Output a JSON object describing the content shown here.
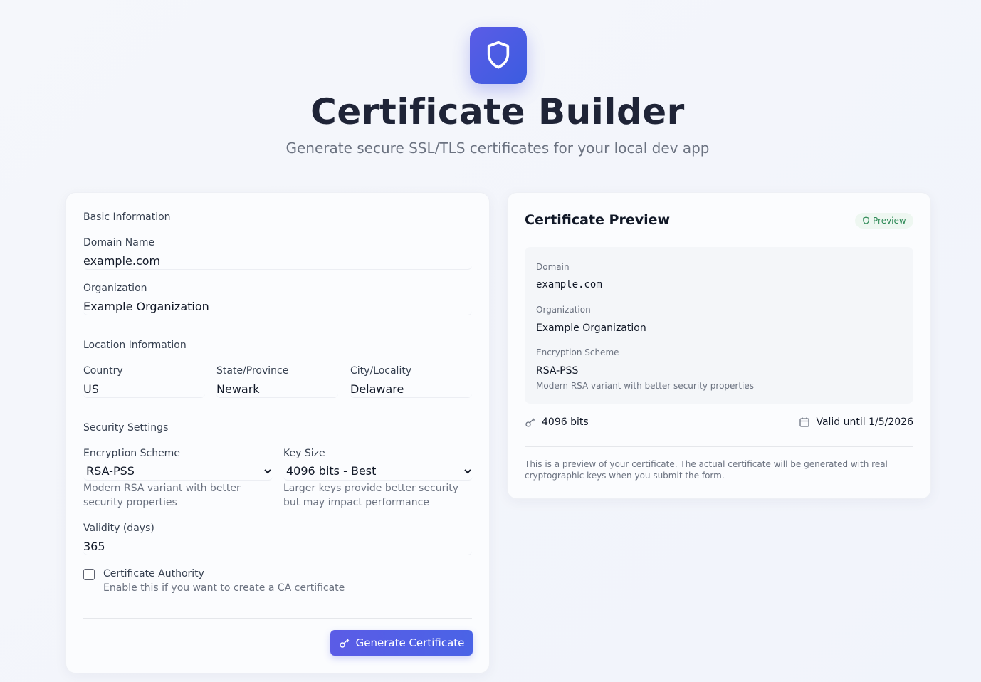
{
  "header": {
    "logo_icon": "shield-icon",
    "title": "Certificate Builder",
    "subtitle": "Generate secure SSL/TLS certificates for your local dev app"
  },
  "form": {
    "basic_section": "Basic Information",
    "domain_label": "Domain Name",
    "domain_value": "example.com",
    "org_label": "Organization",
    "org_value": "Example Organization",
    "location_section": "Location Information",
    "country_label": "Country",
    "country_value": "US",
    "state_label": "State/Province",
    "state_value": "Newark",
    "city_label": "City/Locality",
    "city_value": "Delaware",
    "security_section": "Security Settings",
    "scheme_label": "Encryption Scheme",
    "scheme_value": "RSA-PSS",
    "scheme_help_1": "Modern RSA variant with better",
    "scheme_help_2": "security properties",
    "keysize_label": "Key Size",
    "keysize_value": "4096 bits - Best",
    "keysize_help_1": "Larger keys provide better security",
    "keysize_help_2": "but may impact performance",
    "validity_label": "Validity (days)",
    "validity_value": "365",
    "ca_label": "Certificate Authority",
    "ca_help": "Enable this if you want to create a CA certificate",
    "ca_checked": false,
    "generate_label": "Generate Certificate"
  },
  "preview": {
    "title": "Certificate Preview",
    "badge": "Preview",
    "domain_label": "Domain",
    "domain_value": "example.com",
    "org_label": "Organization",
    "org_value": "Example Organization",
    "scheme_label": "Encryption Scheme",
    "scheme_value": "RSA-PSS",
    "scheme_desc": "Modern RSA variant with better security properties",
    "key_bits": "4096 bits",
    "valid_until": "Valid until 1/5/2026",
    "note_1": "This is a preview of your certificate. The actual certificate will be generated with real",
    "note_2": "cryptographic keys when you submit the form."
  },
  "colors": {
    "accent": "#5b5ce6",
    "badge_green": "#2f8a57"
  }
}
